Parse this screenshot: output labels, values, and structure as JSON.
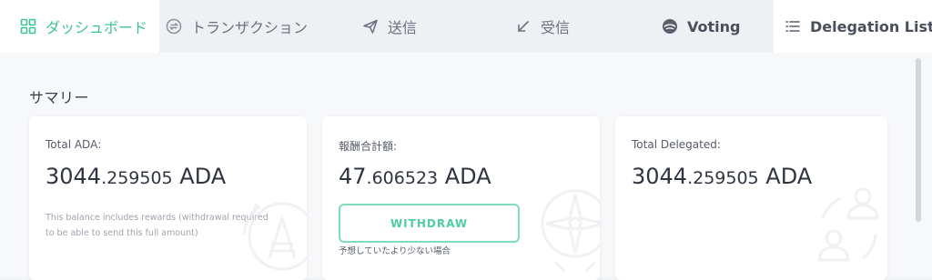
{
  "tabs": [
    {
      "label": "ダッシュボード",
      "icon": "dashboard-icon",
      "active": true
    },
    {
      "label": "トランザクション",
      "icon": "exchange-icon"
    },
    {
      "label": "送信",
      "icon": "send-icon"
    },
    {
      "label": "受信",
      "icon": "receive-icon"
    },
    {
      "label": "Voting",
      "icon": "voting-icon"
    },
    {
      "label": "Delegation List",
      "icon": "list-icon"
    }
  ],
  "summary": {
    "title": "サマリー",
    "total_ada": {
      "label": "Total ADA:",
      "value_int": "3044",
      "value_frac": ".259505",
      "unit": " ADA",
      "note": "This balance includes rewards (withdrawal required to be able to send this full amount)"
    },
    "rewards": {
      "label": "報酬合計額:",
      "value_int": "47",
      "value_frac": ".606523",
      "unit": " ADA",
      "button": "WITHDRAW",
      "hint": "予想していたより少ない場合"
    },
    "total_delegated": {
      "label": "Total Delegated:",
      "value_int": "3044",
      "value_frac": ".259505",
      "unit": " ADA"
    }
  },
  "colors": {
    "accent": "#3cc39a",
    "button_border": "#7fdcbf",
    "text": "#3a3f4b",
    "muted": "#9ea3ae"
  }
}
